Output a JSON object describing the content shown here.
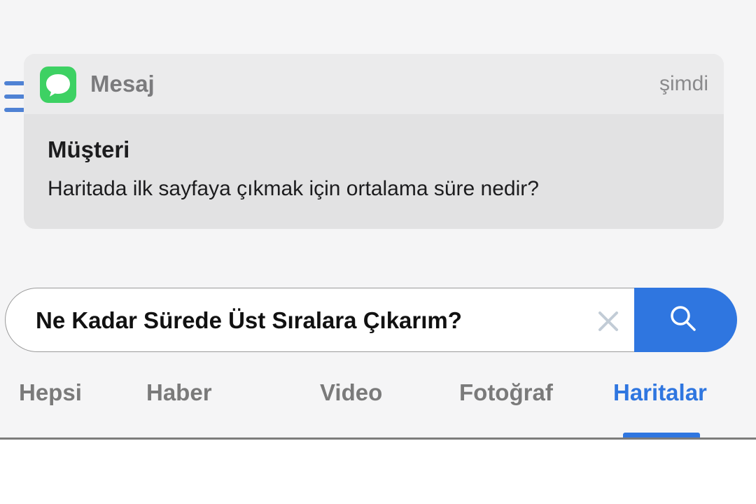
{
  "notification": {
    "app_name": "Mesaj",
    "time": "şimdi",
    "sender": "Müşteri",
    "message": "Haritada ilk sayfaya çıkmak için ortalama süre nedir?",
    "app_icon": "message-bubble-icon"
  },
  "search": {
    "query": "Ne Kadar Sürede Üst Sıralara Çıkarım?",
    "clear_icon": "close-icon",
    "button_icon": "search-icon"
  },
  "tabs": [
    {
      "label": "Hepsi",
      "active": false
    },
    {
      "label": "Haber",
      "active": false
    },
    {
      "label": "Video",
      "active": false
    },
    {
      "label": "Fotoğraf",
      "active": false
    },
    {
      "label": "Haritalar",
      "active": true
    }
  ],
  "colors": {
    "accent": "#2f76e0",
    "app_icon_green": "#3dd163",
    "menu_icon": "#4f82d4"
  }
}
